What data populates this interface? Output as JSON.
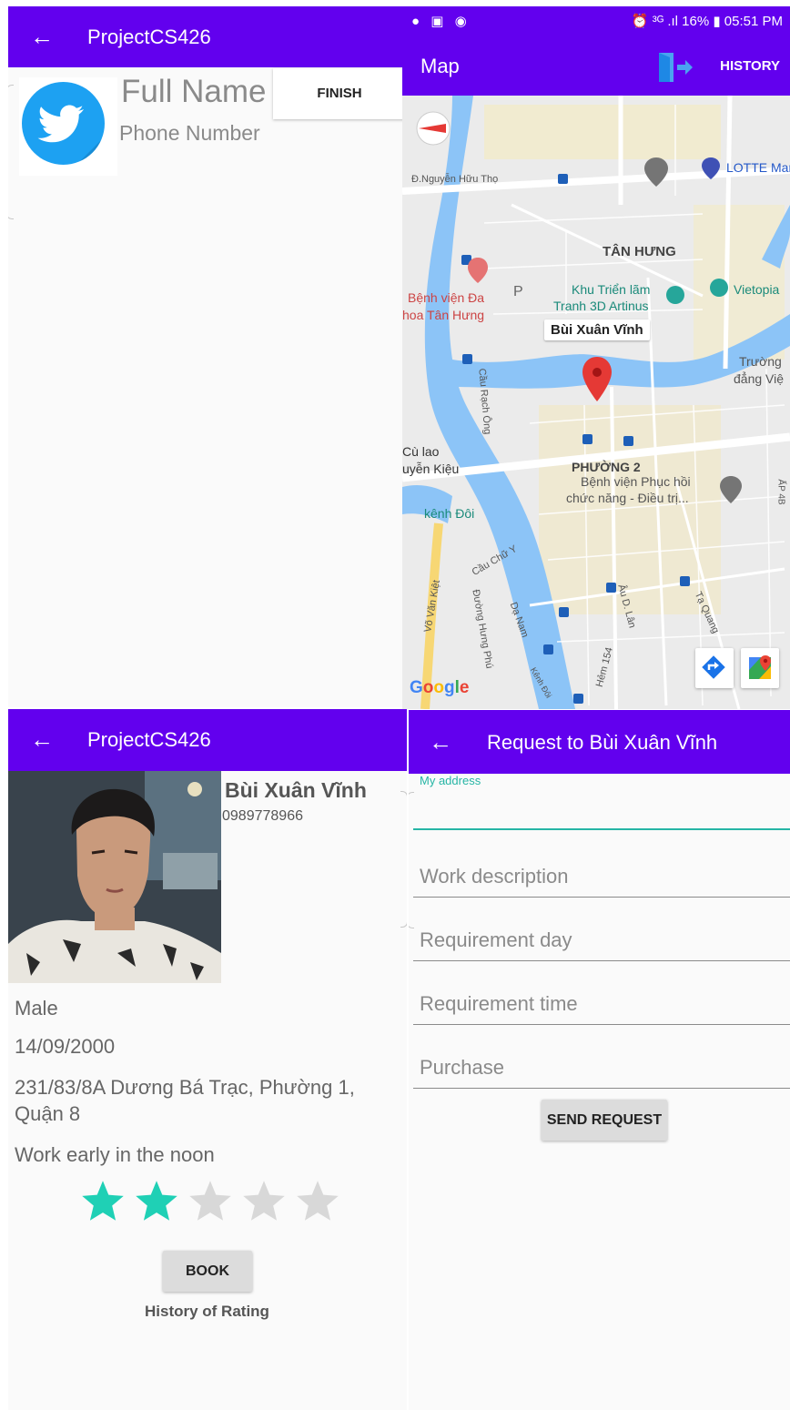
{
  "colors": {
    "primary": "#6200ee",
    "accent": "#26b5a5",
    "star_on": "#1fd0b5",
    "star_off": "#d8d8d8",
    "twitter": "#1da1f2"
  },
  "setup_screen": {
    "title": "ProjectCS426",
    "back_icon": "arrow-back-icon",
    "full_name": "Full Name",
    "phone_number": "Phone Number",
    "finish_label": "FINISH"
  },
  "map_screen": {
    "status_icons_left": [
      "messenger-icon",
      "image-icon",
      "app-icon"
    ],
    "status_right": "⏰ ³ᴳ .ıl 16% ▮ 05:51 PM",
    "title": "Map",
    "exit_icon": "exit-door-icon",
    "history_label": "HISTORY",
    "pin_label": "Bùi Xuân Vĩnh",
    "labels": {
      "nguyen_huu_tho": "Đ.Nguyễn Hữu Thọ",
      "lotte": "LOTTE Mar",
      "tan_hung": "TÂN HƯNG",
      "benh_vien_1": "Bệnh viện Đa",
      "benh_vien_2": "hoa Tân Hưng",
      "khu_trien_lam_1": "Khu Triển lãm",
      "khu_trien_lam_2": "Tranh 3D Artinus",
      "vietopia": "Vietopia",
      "truong_1": "Trường",
      "truong_2": "đẳng Việ",
      "cu_lao_1": "Cù lao",
      "cu_lao_2": "uyễn Kiệu",
      "phuong_2": "PHƯỜNG 2",
      "phuc_hoi_1": "Bệnh viện Phục hồi",
      "phuc_hoi_2": "chức năng - Điều trị...",
      "kenh_doi": "kênh Đôi",
      "cau_chu_y": "Cầu Chữ Y",
      "vo_van_kiet": "Võ Văn Kiệt",
      "cau_rach_ong": "Cầu Rạch Ông",
      "duong_hung_phu": "Đường Hưng Phú",
      "da_nam": "Dạ Nam",
      "au_duong_lan": "Âu D. Lân",
      "hem_154": "Hẻm 154",
      "ta_quang": "Tạ Quang",
      "ap_4b": "ẤP 4B",
      "kenh_doi_small": "Kênh Đôi",
      "p_marker": "P"
    },
    "google_letters": [
      "G",
      "o",
      "o",
      "g",
      "l",
      "e"
    ]
  },
  "profile_screen": {
    "title": "ProjectCS426",
    "name": "Bùi Xuân Vĩnh",
    "phone": "0989778966",
    "gender": "Male",
    "birthday": "14/09/2000",
    "address": "231/83/8A Dương Bá Trạc, Phường 1, Quận 8",
    "note": "Work early in the noon",
    "rating": 2,
    "rating_max": 5,
    "book_label": "BOOK",
    "history_label": "History of Rating"
  },
  "request_screen": {
    "title": "Request to Bùi Xuân Vĩnh",
    "my_address_label": "My address",
    "my_address_value": "",
    "work_description": "Work description",
    "requirement_day": "Requirement day",
    "requirement_time": "Requirement time",
    "purchase": "Purchase",
    "send_label": "SEND REQUEST"
  }
}
